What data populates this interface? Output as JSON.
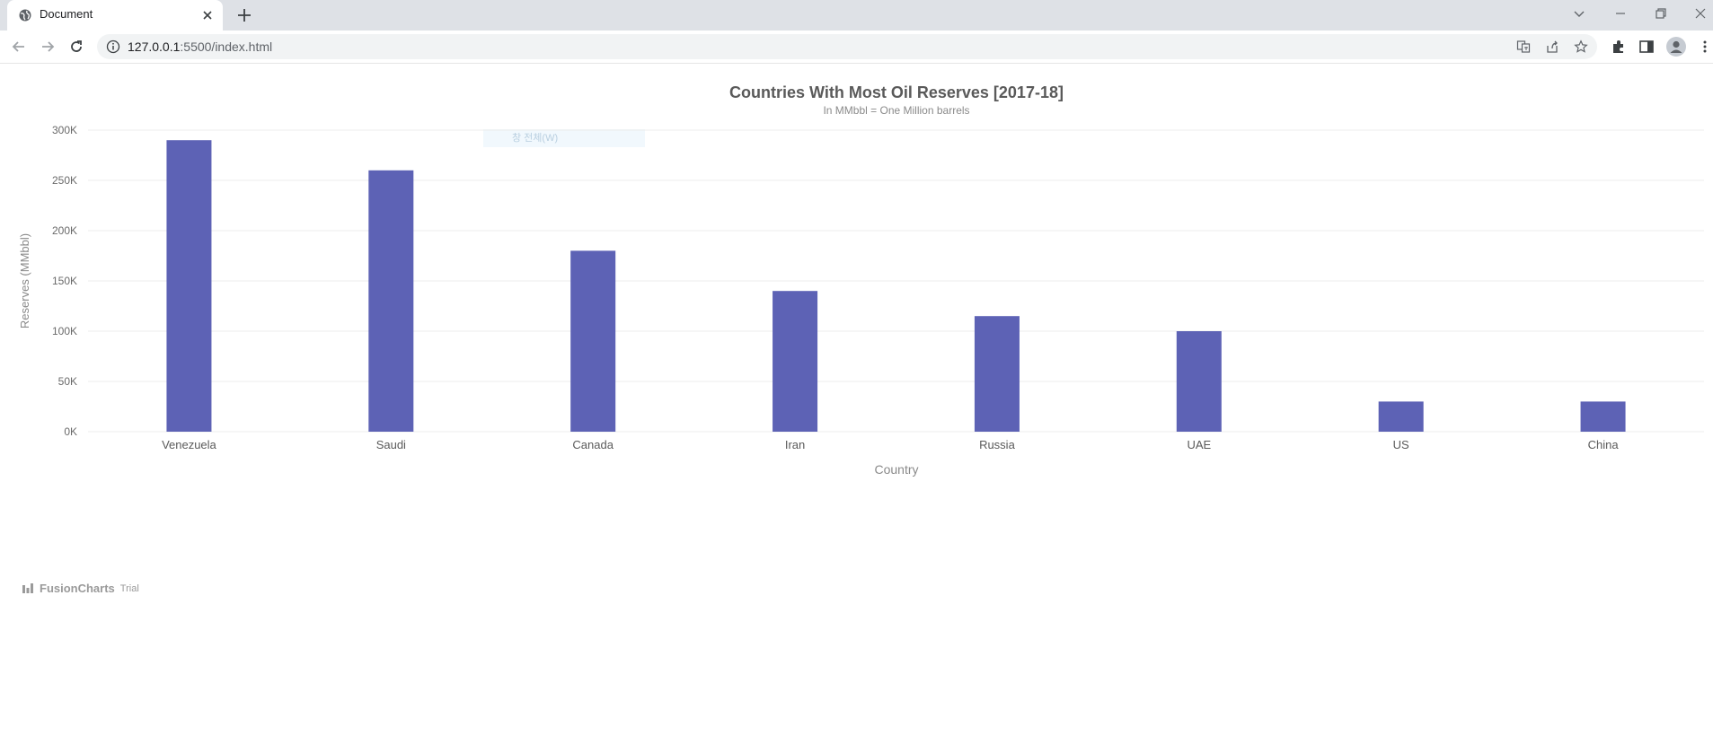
{
  "browser": {
    "tab_title": "Document",
    "url_host": "127.0.0.1",
    "url_rest": ":5500/index.html"
  },
  "chart_data": {
    "type": "bar",
    "title": "Countries With Most Oil Reserves [2017-18]",
    "subtitle": "In MMbbl = One Million barrels",
    "xlabel": "Country",
    "ylabel": "Reserves (MMbbl)",
    "categories": [
      "Venezuela",
      "Saudi",
      "Canada",
      "Iran",
      "Russia",
      "UAE",
      "US",
      "China"
    ],
    "values": [
      290000,
      260000,
      180000,
      140000,
      115000,
      100000,
      30000,
      30000
    ],
    "ylim": [
      0,
      300000
    ],
    "yticks": [
      "0K",
      "50K",
      "100K",
      "150K",
      "200K",
      "250K",
      "300K"
    ],
    "grid": true,
    "bar_color": "#5d62b5"
  },
  "watermark_text": "창 전체(W)",
  "footer": {
    "brand": "FusionCharts",
    "trial": "Trial"
  }
}
